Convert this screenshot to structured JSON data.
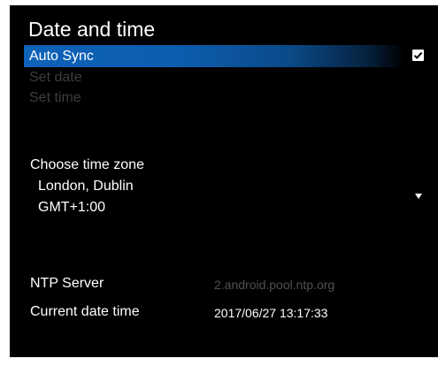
{
  "title": "Date and time",
  "menu": {
    "auto_sync": {
      "label": "Auto Sync",
      "checked": true
    },
    "set_date": {
      "label": "Set date"
    },
    "set_time": {
      "label": "Set time"
    }
  },
  "time_zone": {
    "label": "Choose time zone",
    "city": "London, Dublin",
    "offset": "GMT+1:00"
  },
  "ntp": {
    "label": "NTP Server",
    "value": "2.android.pool.ntp.org"
  },
  "current": {
    "label": "Current date time",
    "value": "2017/06/27 13:17:33"
  },
  "colors": {
    "background": "#000000",
    "highlight": "#0e62b8",
    "text": "#ffffff",
    "disabled_text": "#3e3e3e",
    "muted_value": "#505050"
  },
  "icons": {
    "auto_sync_checkbox": "checkmark-icon",
    "time_zone_dropdown": "triangle-down-icon"
  }
}
